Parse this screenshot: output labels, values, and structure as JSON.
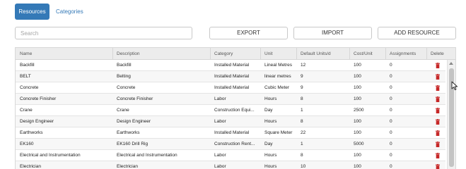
{
  "tabs": [
    {
      "label": "Resources",
      "active": true
    },
    {
      "label": "Categories",
      "active": false
    }
  ],
  "search": {
    "placeholder": "Search",
    "value": ""
  },
  "toolbar": {
    "export_label": "EXPORT",
    "import_label": "IMPORT",
    "add_label": "ADD RESOURCE"
  },
  "table": {
    "headers": [
      "Name",
      "Description",
      "Category",
      "Unit",
      "Default Units/d",
      "Cost/Unit",
      "Assignments",
      "Delete"
    ],
    "rows": [
      {
        "name": "Backfill",
        "description": "Backfill",
        "category": "Installed Material",
        "unit": "Lineal Metres",
        "units_per_day": "12",
        "cost_per_unit": "100",
        "assignments": "0"
      },
      {
        "name": "BELT",
        "description": "Belting",
        "category": "Installed Material",
        "unit": "linear metres",
        "units_per_day": "9",
        "cost_per_unit": "100",
        "assignments": "0"
      },
      {
        "name": "Concrete",
        "description": "Concrete",
        "category": "Installed Material",
        "unit": "Cubic Meter",
        "units_per_day": "9",
        "cost_per_unit": "100",
        "assignments": "0"
      },
      {
        "name": "Concrete Finisher",
        "description": "Concrete Finisher",
        "category": "Labor",
        "unit": "Hours",
        "units_per_day": "8",
        "cost_per_unit": "100",
        "assignments": "0"
      },
      {
        "name": "Crane",
        "description": "Crane",
        "category": "Construction Equi...",
        "unit": "Day",
        "units_per_day": "1",
        "cost_per_unit": "2500",
        "assignments": "0"
      },
      {
        "name": "Design Engineer",
        "description": "Design Engineer",
        "category": "Labor",
        "unit": "Hours",
        "units_per_day": "8",
        "cost_per_unit": "100",
        "assignments": "0"
      },
      {
        "name": "Earthworks",
        "description": "Earthworks",
        "category": "Installed Material",
        "unit": "Square Meter",
        "units_per_day": "22",
        "cost_per_unit": "100",
        "assignments": "0"
      },
      {
        "name": "EK160",
        "description": "EK160 Drill Rig",
        "category": "Construction Rent...",
        "unit": "Day",
        "units_per_day": "1",
        "cost_per_unit": "5000",
        "assignments": "0"
      },
      {
        "name": "Electrical and Instrumentation",
        "description": "Electrical and Instrumentation",
        "category": "Labor",
        "unit": "Hours",
        "units_per_day": "8",
        "cost_per_unit": "100",
        "assignments": "0"
      },
      {
        "name": "Electrician",
        "description": "Electrician",
        "category": "Labor",
        "unit": "Hours",
        "units_per_day": "10",
        "cost_per_unit": "100",
        "assignments": "0"
      }
    ]
  },
  "colors": {
    "accent": "#3479b7",
    "delete": "#c62828"
  },
  "icons": {
    "delete": "trash-icon"
  }
}
